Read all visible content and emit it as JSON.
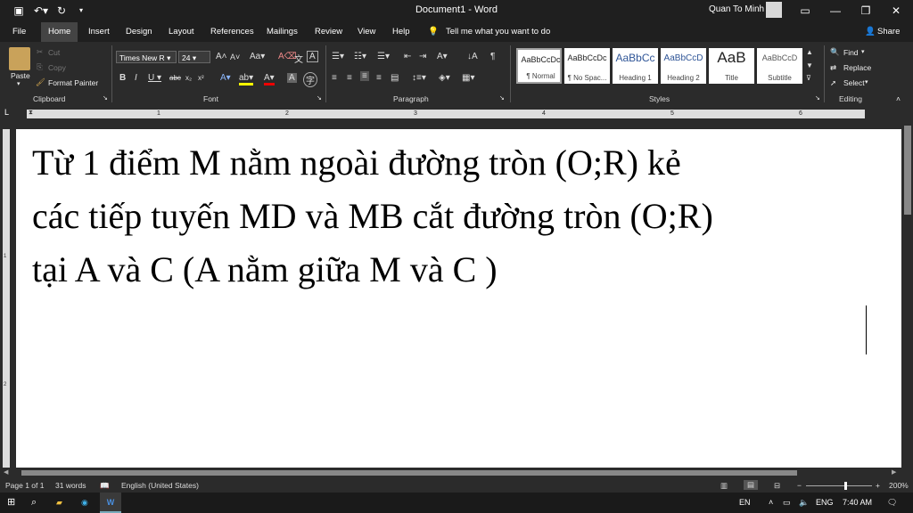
{
  "window": {
    "title": "Document1 - Word",
    "user": "Quan To Minh"
  },
  "tabs": [
    "File",
    "Home",
    "Insert",
    "Design",
    "Layout",
    "References",
    "Mailings",
    "Review",
    "View",
    "Help"
  ],
  "tell_me": "Tell me what you want to do",
  "share": "Share",
  "clipboard": {
    "paste": "Paste",
    "cut": "Cut",
    "copy": "Copy",
    "format_painter": "Format Painter",
    "group": "Clipboard"
  },
  "font": {
    "name": "Times New R",
    "size": "24",
    "group": "Font"
  },
  "paragraph": {
    "group": "Paragraph"
  },
  "styles": {
    "group": "Styles",
    "items": [
      {
        "preview": "AaBbCcDc",
        "name": "¶ Normal"
      },
      {
        "preview": "AaBbCcDc",
        "name": "¶ No Spac..."
      },
      {
        "preview": "AaBbCc",
        "name": "Heading 1"
      },
      {
        "preview": "AaBbCcD",
        "name": "Heading 2"
      },
      {
        "preview": "AaB",
        "name": "Title"
      },
      {
        "preview": "AaBbCcD",
        "name": "Subtitle"
      }
    ]
  },
  "editing": {
    "find": "Find",
    "replace": "Replace",
    "select": "Select",
    "group": "Editing"
  },
  "ruler": [
    "1",
    "2",
    "3",
    "4",
    "5",
    "6"
  ],
  "document": {
    "lines": [
      "Từ 1 điểm M nằm ngoài đường tròn (O;R) kẻ",
      "các tiếp tuyến MD và MB cắt đường tròn (O;R)",
      "tại A và C (A nằm giữa M và C )"
    ]
  },
  "status": {
    "page": "Page 1 of 1",
    "words": "31 words",
    "language": "English (United States)",
    "zoom": "200%"
  },
  "taskbar": {
    "lang": "EN",
    "input": "ENG",
    "time": "7:40 AM"
  }
}
